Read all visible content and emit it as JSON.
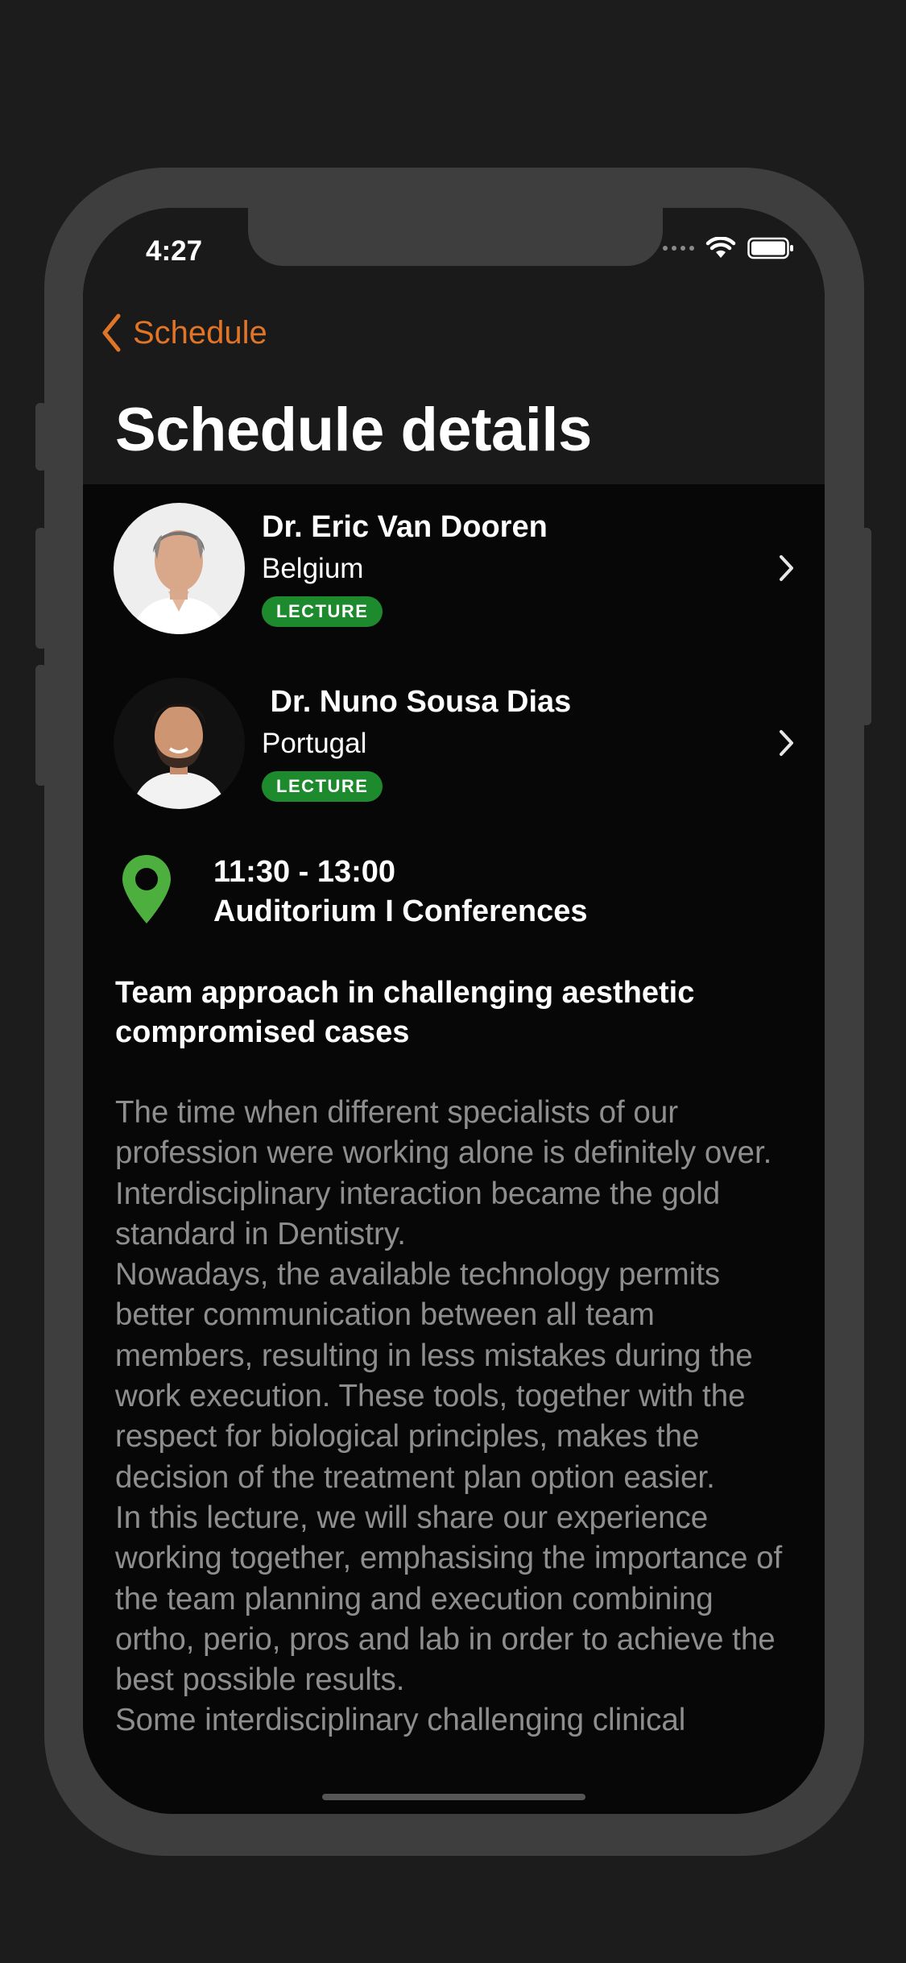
{
  "status_bar": {
    "time": "4:27"
  },
  "nav": {
    "back_label": "Schedule",
    "title": "Schedule details"
  },
  "speakers": [
    {
      "name": "Dr. Eric Van Dooren",
      "country": "Belgium",
      "badge": "LECTURE"
    },
    {
      "name": " Dr. Nuno Sousa Dias",
      "country": "Portugal",
      "badge": "LECTURE"
    }
  ],
  "session": {
    "time": "11:30 - 13:00",
    "room": "Auditorium I Conferences",
    "title": "Team approach in challenging aesthetic compromised cases",
    "description": "The time when different specialists of our profession were working alone is definitely over. Interdisciplinary interaction became the gold standard in Dentistry.\nNowadays, the available technology permits better communication between all team members, resulting in less mistakes during the work execution. These tools, together with the respect for biological principles, makes the decision of the treatment plan option easier.\nIn this lecture, we will share our experience working together, emphasising the importance of the team planning and execution combining ortho, perio, pros and lab in order to achieve the best possible results.\nSome interdisciplinary challenging clinical"
  },
  "colors": {
    "accent": "#e07427",
    "badge": "#1e8a2e",
    "pin": "#4caf3e",
    "background": "#070707",
    "header": "#1a1a1a"
  }
}
